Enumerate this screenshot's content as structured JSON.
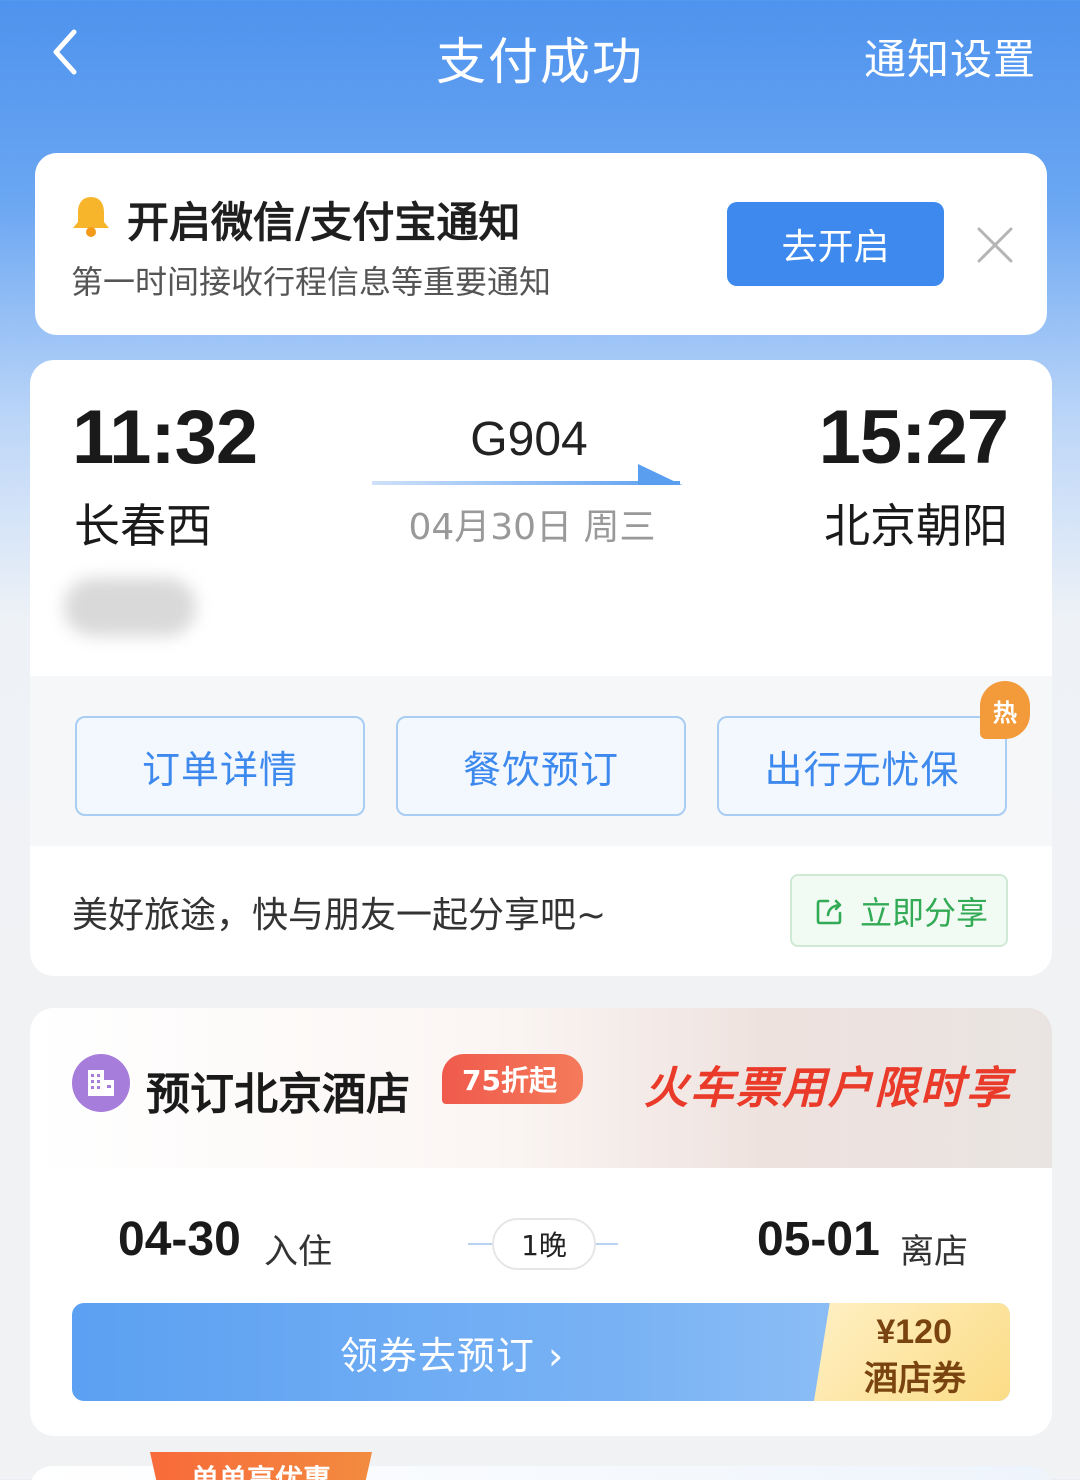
{
  "header": {
    "title": "支付成功",
    "settings_label": "通知设置"
  },
  "notice": {
    "title": "开启微信/支付宝通知",
    "subtitle": "第一时间接收行程信息等重要通知",
    "enable_label": "去开启"
  },
  "trip": {
    "departure_time": "11:32",
    "departure_station": "长春西",
    "arrival_time": "15:27",
    "arrival_station": "北京朝阳",
    "train_number": "G904",
    "date": "04月30日 周三",
    "actions": [
      {
        "label": "订单详情"
      },
      {
        "label": "餐饮预订"
      },
      {
        "label": "出行无忧保"
      }
    ],
    "hot_badge": "热",
    "share_text": "美好旅途，快与朋友一起分享吧~",
    "share_label": "立即分享"
  },
  "hotel": {
    "title": "预订北京酒店",
    "discount_badge": "75折起",
    "promo_slogan": "火车票用户限时享",
    "checkin_date": "04-30",
    "checkin_label": "入住",
    "nights": "1晚",
    "checkout_date": "05-01",
    "checkout_label": "离店",
    "book_label": "领券去预订 ›",
    "coupon_amount": "¥120",
    "coupon_name": "酒店券"
  },
  "bottom": {
    "badge": "单单享优惠"
  },
  "colors": {
    "primary_blue": "#3d89ee",
    "share_green": "#33aa55",
    "hot_orange": "#f39a3b",
    "promo_red": "#ea3a2a"
  }
}
